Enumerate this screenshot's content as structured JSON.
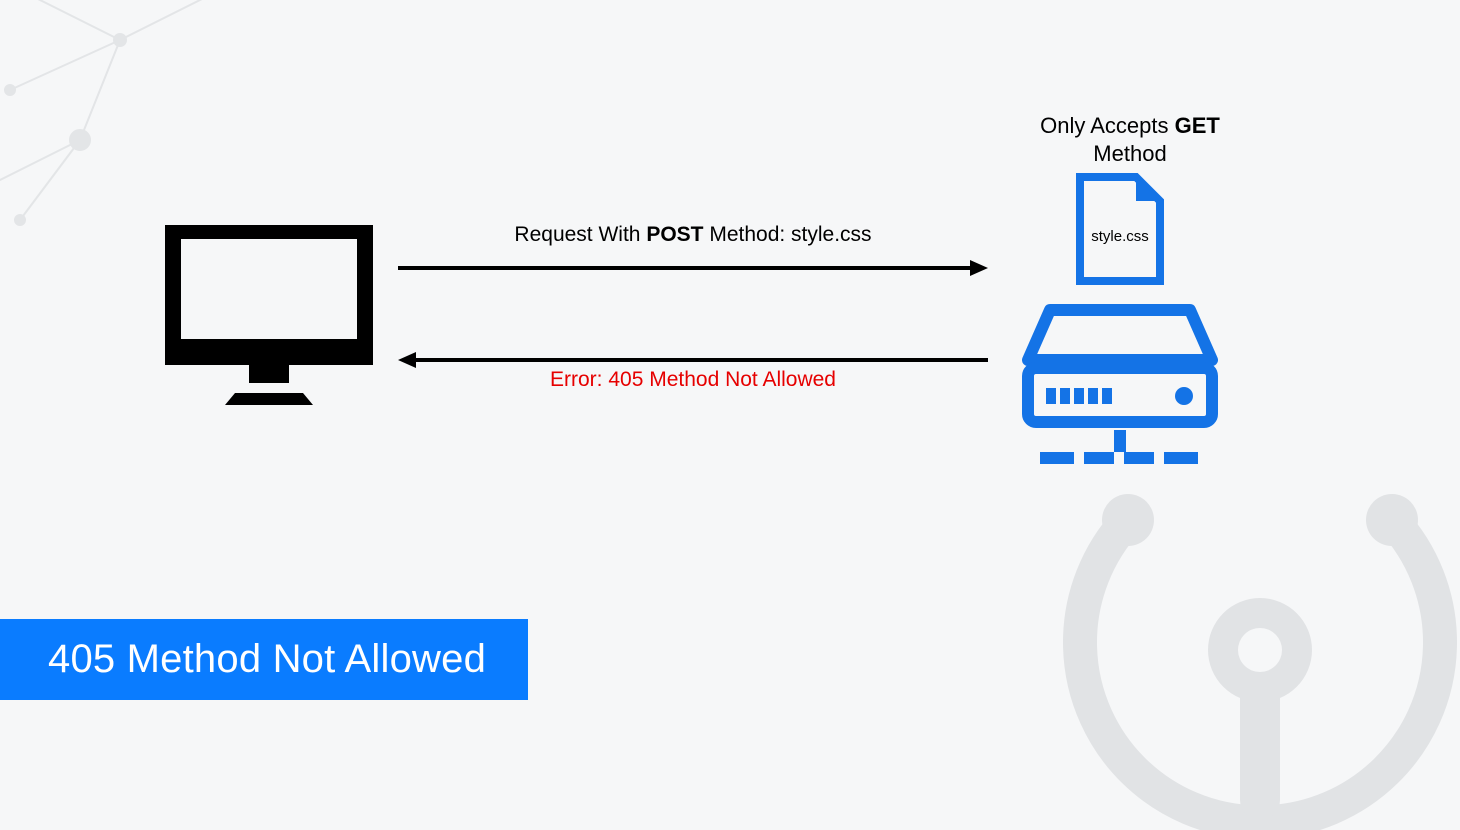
{
  "request_label": {
    "prefix": "Request With ",
    "bold": "POST",
    "suffix": " Method: style.css"
  },
  "error_label": "Error: 405 Method Not Allowed",
  "server_caption": {
    "prefix": "Only Accepts ",
    "bold": "GET",
    "suffix_line2": "Method"
  },
  "file_name": "style.css",
  "banner": "405 Method Not Allowed",
  "colors": {
    "accent": "#0a7cff",
    "error": "#e60000",
    "blue": "#1473e6"
  }
}
